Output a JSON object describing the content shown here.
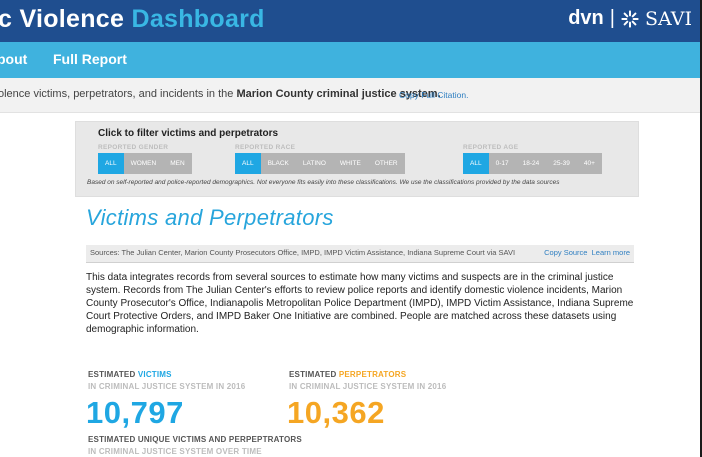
{
  "header": {
    "title_part1": "c Violence",
    "title_part2": "Dashboard",
    "brand_dvn": "dvn",
    "brand_separator": "|",
    "brand_savi": "SAVI"
  },
  "nav": {
    "items": [
      {
        "label": "bout"
      },
      {
        "label": "Full Report"
      }
    ]
  },
  "intro": {
    "text_before": "olence victims, perpetrators, and incidents in the ",
    "text_bold": "Marion County criminal justice system.",
    "citation_link": "Copy Full Citation."
  },
  "filter": {
    "title": "Click to filter victims and perpetrators",
    "gender": {
      "label": "REPORTED GENDER",
      "options": [
        "ALL",
        "WOMEN",
        "MEN"
      ],
      "selected": "ALL"
    },
    "race": {
      "label": "REPORTED RACE",
      "options": [
        "ALL",
        "BLACK",
        "LATINO",
        "WHITE",
        "OTHER"
      ],
      "selected": "ALL"
    },
    "age": {
      "label": "REPORTED AGE",
      "options": [
        "ALL",
        "0-17",
        "18-24",
        "25-39",
        "40+"
      ],
      "selected": "ALL"
    },
    "note": "Based on self-reported and police-reported demographics. Not everyone fits easily into these classifications. We use the classifications provided by the data sources"
  },
  "section": {
    "title": "Victims and Perpetrators",
    "sources": "Sources: The Julian Center, Marion County Prosecutors Office, IMPD, IMPD Victim Assistance, Indiana Supreme Court via SAVI",
    "copy_source": "Copy Source",
    "learn_more": "Learn more",
    "paragraph": "This data integrates records from several sources to estimate how many victims and suspects are in the criminal justice system. Records from The Julian Center's efforts to review police reports and identify domestic violence incidents, Marion County Prosecutor's Office, Indianapolis Metropolitan Police Department (IMPD), IMPD Victim Assistance, Indiana Supreme Court Protective Orders, and IMPD Baker One Initiative are combined. People are matched across these datasets using demographic information."
  },
  "stats": {
    "victims": {
      "prefix": "ESTIMATED ",
      "highlight": "VICTIMS",
      "sub": "IN CRIMINAL JUSTICE SYSTEM IN 2016",
      "value": "10,797",
      "color": "#1fa7e3"
    },
    "perpetrators": {
      "prefix": "ESTIMATED ",
      "highlight": "PERPETRATORS",
      "sub": "IN CRIMINAL JUSTICE SYSTEM IN 2016",
      "value": "10,362",
      "color": "#f5a623"
    },
    "unique": {
      "label": "ESTIMATED UNIQUE VICTIMS AND PERPEPTRATORS",
      "sub": "IN CRIMINAL JUSTICE SYSTEM OVER TIME"
    }
  },
  "colors": {
    "header_bg": "#1f4e8f",
    "nav_bg": "#3fb2de",
    "accent_blue": "#1fa7e3",
    "accent_orange": "#f5a623"
  }
}
